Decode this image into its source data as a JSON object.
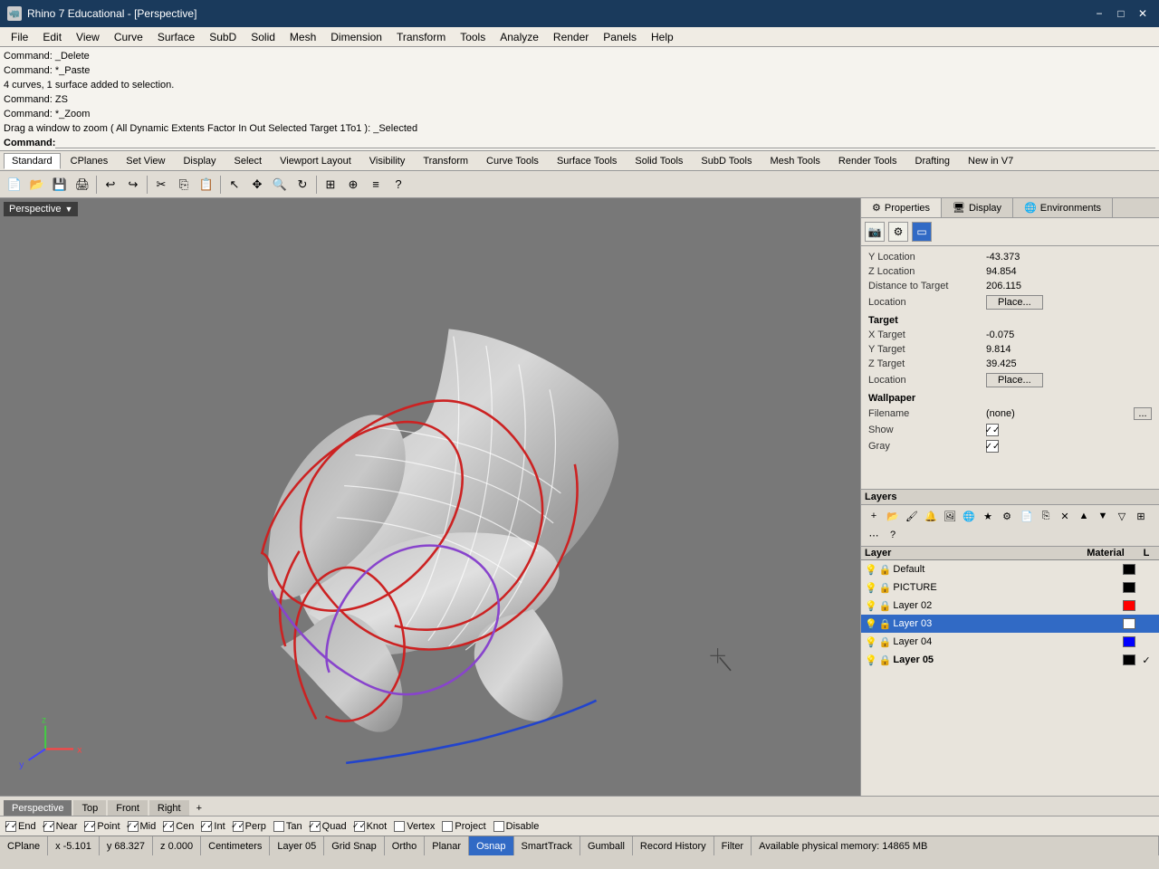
{
  "titlebar": {
    "icon": "🦏",
    "title": "Rhino 7 Educational - [Perspective]",
    "minimize": "−",
    "maximize": "□",
    "close": "✕"
  },
  "menubar": {
    "items": [
      "File",
      "Edit",
      "View",
      "Curve",
      "Surface",
      "SubD",
      "Solid",
      "Mesh",
      "Dimension",
      "Transform",
      "Tools",
      "Analyze",
      "Render",
      "Panels",
      "Help"
    ]
  },
  "command_area": {
    "lines": [
      "Command: _Delete",
      "Command: *_Paste",
      "4 curves, 1 surface added to selection.",
      "Command: ZS",
      "Command: *_Zoom"
    ],
    "drag_hint": "Drag a window to zoom ( All  Dynamic  Extents  Factor  In  Out  Selected  Target  1To1 ): _Selected",
    "prompt": "Command:"
  },
  "toolbar_tabs": {
    "items": [
      "Standard",
      "CPlanes",
      "Set View",
      "Display",
      "Select",
      "Viewport Layout",
      "Visibility",
      "Transform",
      "Curve Tools",
      "Surface Tools",
      "Solid Tools",
      "SubD Tools",
      "Mesh Tools",
      "Render Tools",
      "Drafting",
      "New in V7"
    ],
    "active": "Standard"
  },
  "viewport": {
    "label": "Perspective",
    "background": "#787878"
  },
  "right_panel": {
    "tabs": [
      "Properties",
      "Display",
      "Environments"
    ],
    "active_tab": "Properties",
    "tab_icons": [
      "camera",
      "settings",
      "rectangle"
    ],
    "properties": {
      "y_location_label": "Y Location",
      "y_location_value": "-43.373",
      "z_location_label": "Z Location",
      "z_location_value": "94.854",
      "distance_label": "Distance to Target",
      "distance_value": "206.115",
      "location_label": "Location",
      "location_btn": "Place...",
      "target_section": "Target",
      "x_target_label": "X Target",
      "x_target_value": "-0.075",
      "y_target_label": "Y Target",
      "y_target_value": "9.814",
      "z_target_label": "Z Target",
      "z_target_value": "39.425",
      "target_location_label": "Location",
      "target_location_btn": "Place...",
      "wallpaper_section": "Wallpaper",
      "filename_label": "Filename",
      "filename_value": "(none)",
      "filename_btn": "...",
      "show_label": "Show",
      "gray_label": "Gray"
    }
  },
  "layers": {
    "header": "Layers",
    "columns": {
      "layer": "Layer",
      "material": "Material",
      "l": "L"
    },
    "items": [
      {
        "name": "Default",
        "visible": true,
        "locked": false,
        "color": "#000000",
        "material": "",
        "active": false
      },
      {
        "name": "PICTURE",
        "visible": true,
        "locked": false,
        "color": "#000000",
        "material": "",
        "active": false
      },
      {
        "name": "Layer 02",
        "visible": true,
        "locked": false,
        "color": "#ff0000",
        "material": "",
        "active": false
      },
      {
        "name": "Layer 03",
        "visible": true,
        "locked": false,
        "color": "#ffffff",
        "material": "",
        "active": true
      },
      {
        "name": "Layer 04",
        "visible": true,
        "locked": false,
        "color": "#0000ff",
        "material": "",
        "active": false
      },
      {
        "name": "Layer 05",
        "visible": false,
        "locked": false,
        "color": "#000000",
        "material": "",
        "active": false
      }
    ]
  },
  "bottom_tabs": {
    "items": [
      "Perspective",
      "Top",
      "Front",
      "Right"
    ],
    "active": "Perspective",
    "add_icon": "+"
  },
  "snapbar": {
    "items": [
      {
        "label": "End",
        "checked": true
      },
      {
        "label": "Near",
        "checked": true
      },
      {
        "label": "Point",
        "checked": true
      },
      {
        "label": "Mid",
        "checked": true
      },
      {
        "label": "Cen",
        "checked": true
      },
      {
        "label": "Int",
        "checked": true
      },
      {
        "label": "Perp",
        "checked": true
      },
      {
        "label": "Tan",
        "checked": false
      },
      {
        "label": "Quad",
        "checked": true
      },
      {
        "label": "Knot",
        "checked": true
      },
      {
        "label": "Vertex",
        "checked": false
      },
      {
        "label": "Project",
        "checked": false
      },
      {
        "label": "Disable",
        "checked": false
      }
    ]
  },
  "statusbar": {
    "cplane": "CPlane",
    "x": "x -5.101",
    "y": "y 68.327",
    "z": "z 0.000",
    "units": "Centimeters",
    "layer": "Layer 05",
    "grid_snap": "Grid Snap",
    "ortho": "Ortho",
    "planar": "Planar",
    "osnap": "Osnap",
    "smarttrack": "SmartTrack",
    "gumball": "Gumball",
    "record_history": "Record History",
    "filter": "Filter",
    "memory": "Available physical memory: 14865 MB"
  }
}
